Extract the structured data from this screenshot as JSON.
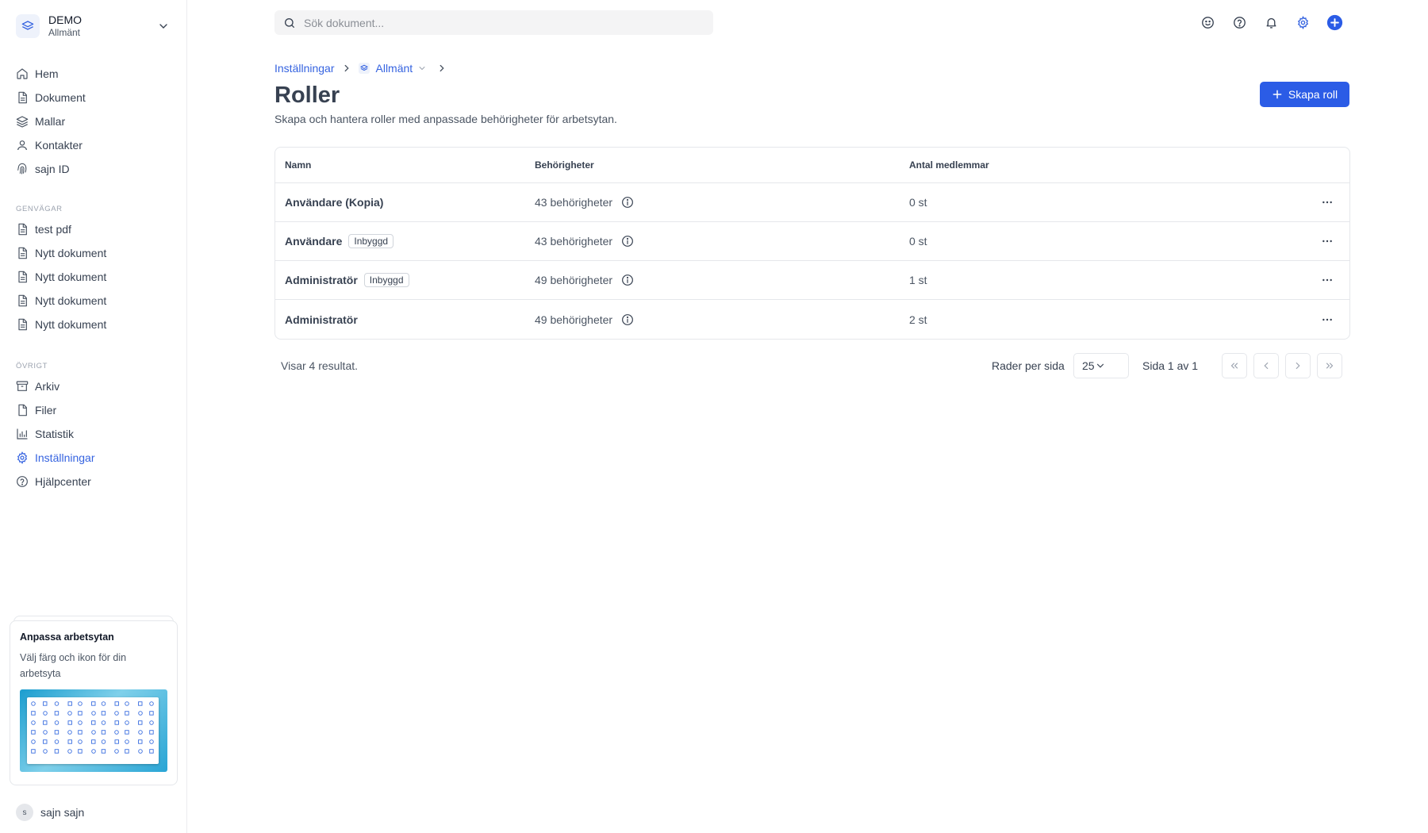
{
  "workspace": {
    "name": "DEMO",
    "subtitle": "Allmänt"
  },
  "nav": {
    "main": [
      {
        "label": "Hem",
        "icon": "home-icon"
      },
      {
        "label": "Dokument",
        "icon": "document-icon"
      },
      {
        "label": "Mallar",
        "icon": "layers-icon"
      },
      {
        "label": "Kontakter",
        "icon": "user-icon"
      },
      {
        "label": "sajn ID",
        "icon": "fingerprint-icon"
      }
    ],
    "shortcuts_title": "GENVÄGAR",
    "shortcuts": [
      {
        "label": "test pdf",
        "icon": "document-icon"
      },
      {
        "label": "Nytt dokument",
        "icon": "document-icon"
      },
      {
        "label": "Nytt dokument",
        "icon": "document-icon"
      },
      {
        "label": "Nytt dokument",
        "icon": "document-icon"
      },
      {
        "label": "Nytt dokument",
        "icon": "document-icon"
      }
    ],
    "other_title": "ÖVRIGT",
    "other": [
      {
        "label": "Arkiv",
        "icon": "archive-icon"
      },
      {
        "label": "Filer",
        "icon": "file-icon"
      },
      {
        "label": "Statistik",
        "icon": "chart-icon"
      },
      {
        "label": "Inställningar",
        "icon": "gear-icon",
        "active": true
      },
      {
        "label": "Hjälpcenter",
        "icon": "help-icon"
      }
    ]
  },
  "promo": {
    "title": "Anpassa arbetsytan",
    "text": "Välj färg och ikon för din arbetsyta"
  },
  "user": {
    "initial": "s",
    "name": "sajn sajn"
  },
  "search": {
    "placeholder": "Sök dokument..."
  },
  "breadcrumb": {
    "settings": "Inställningar",
    "workspace": "Allmänt"
  },
  "page": {
    "title": "Roller",
    "subtitle": "Skapa och hantera roller med anpassade behörigheter för arbetsytan.",
    "create_label": "Skapa roll"
  },
  "table": {
    "headers": {
      "name": "Namn",
      "permissions": "Behörigheter",
      "members": "Antal medlemmar"
    },
    "rows": [
      {
        "name": "Användare (Kopia)",
        "badge": "",
        "permissions": "43 behörigheter",
        "members": "0 st"
      },
      {
        "name": "Användare",
        "badge": "Inbyggd",
        "permissions": "43 behörigheter",
        "members": "0 st"
      },
      {
        "name": "Administratör",
        "badge": "Inbyggd",
        "permissions": "49 behörigheter",
        "members": "1 st"
      },
      {
        "name": "Administratör",
        "badge": "",
        "permissions": "49 behörigheter",
        "members": "2 st"
      }
    ]
  },
  "footer": {
    "results": "Visar 4 resultat.",
    "rows_label": "Rader per sida",
    "rows_value": "25",
    "page_label": "Sida 1 av 1"
  },
  "colors": {
    "accent": "#2b5ce6",
    "link": "#3563e0"
  }
}
